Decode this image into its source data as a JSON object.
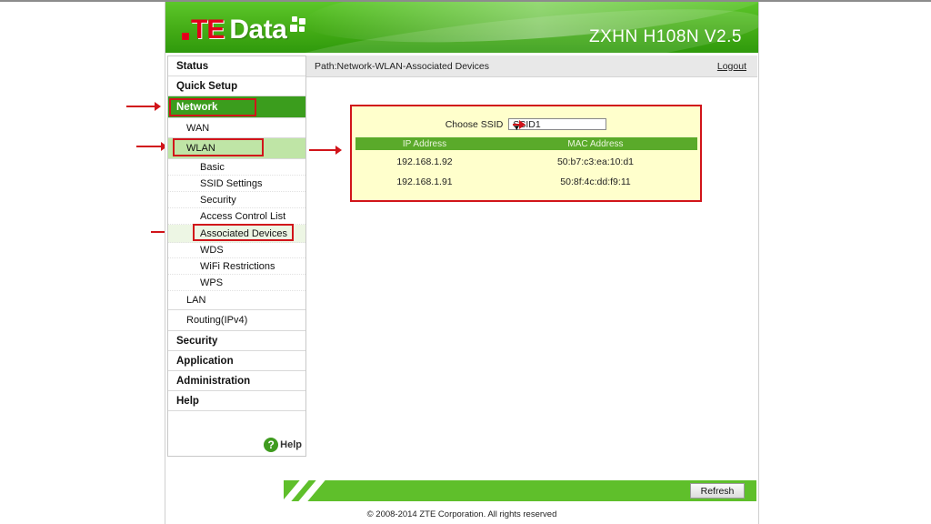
{
  "header": {
    "logo_te": "TE",
    "logo_data": "Data",
    "model": "ZXHN H108N V2.5"
  },
  "sidebar": {
    "items": [
      {
        "label": "Status"
      },
      {
        "label": "Quick Setup"
      },
      {
        "label": "Network"
      },
      {
        "label": "WAN"
      },
      {
        "label": "WLAN"
      },
      {
        "label": "Basic"
      },
      {
        "label": "SSID Settings"
      },
      {
        "label": "Security"
      },
      {
        "label": "Access Control List"
      },
      {
        "label": "Associated Devices"
      },
      {
        "label": "WDS"
      },
      {
        "label": "WiFi Restrictions"
      },
      {
        "label": "WPS"
      },
      {
        "label": "LAN"
      },
      {
        "label": "Routing(IPv4)"
      },
      {
        "label": "Security"
      },
      {
        "label": "Application"
      },
      {
        "label": "Administration"
      },
      {
        "label": "Help"
      }
    ],
    "help_label": "Help",
    "help_icon_glyph": "?"
  },
  "path": {
    "text": "Path:Network-WLAN-Associated Devices",
    "logout": "Logout"
  },
  "main": {
    "ssid_label": "Choose SSID",
    "ssid_value": "SSID1",
    "table": {
      "headers": [
        "IP Address",
        "MAC Address"
      ],
      "rows": [
        [
          "192.168.1.92",
          "50:b7:c3:ea:10:d1"
        ],
        [
          "192.168.1.91",
          "50:8f:4c:dd:f9:11"
        ]
      ]
    }
  },
  "footer": {
    "refresh": "Refresh",
    "copyright": "© 2008-2014 ZTE Corporation. All rights reserved"
  },
  "colors": {
    "brand_green": "#44ac16",
    "annotation_red": "#d1141a",
    "panel_bg": "#ffffcc"
  }
}
